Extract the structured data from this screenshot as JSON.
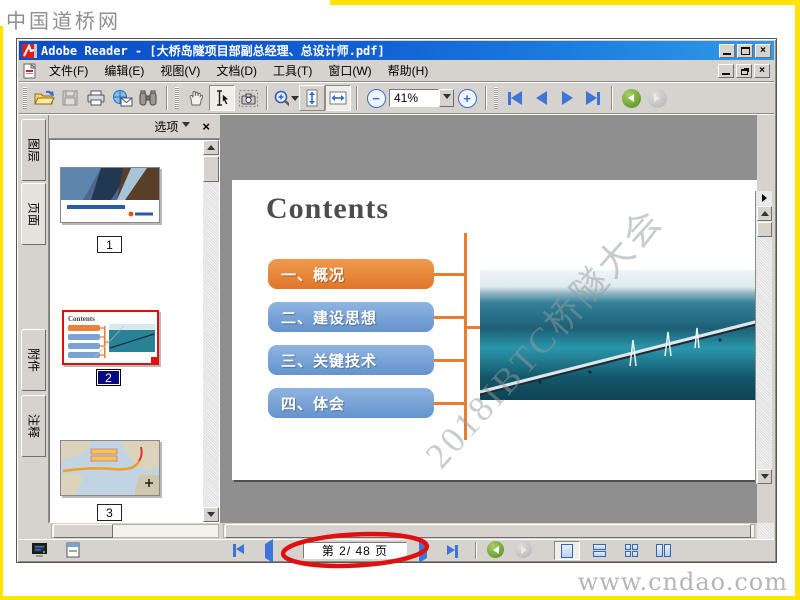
{
  "page": {
    "watermark_top_left": "中国道桥网",
    "watermark_bottom_right": "www.cndao.com",
    "frame_color": "#ffe400"
  },
  "window": {
    "title": "Adobe Reader - [大桥岛隧项目部副总经理、总设计师.pdf]",
    "controls": [
      "minimize",
      "maximize",
      "close"
    ]
  },
  "menu": {
    "items": [
      {
        "label": "文件(F)"
      },
      {
        "label": "编辑(E)"
      },
      {
        "label": "视图(V)"
      },
      {
        "label": "文档(D)"
      },
      {
        "label": "工具(T)"
      },
      {
        "label": "窗口(W)"
      },
      {
        "label": "帮助(H)"
      }
    ],
    "mdi_controls": [
      "minimize",
      "restore",
      "close"
    ]
  },
  "toolbar": {
    "zoom_value": "41%",
    "icons": [
      "open",
      "save",
      "print",
      "email",
      "search",
      "hand-tool",
      "select-tool",
      "snapshot",
      "zoom-tool",
      "fit-page",
      "fit-width",
      "zoom-out",
      "zoom-in",
      "first-page",
      "previous-page",
      "next-page",
      "last-page",
      "go-back",
      "go-forward"
    ],
    "active_tools": [
      "select-tool",
      "fit-width"
    ]
  },
  "sidebar": {
    "tabs": [
      {
        "label": "图层",
        "active": false
      },
      {
        "label": "页面",
        "active": true
      },
      {
        "label": "附件",
        "active": false
      },
      {
        "label": "注释",
        "active": false
      }
    ],
    "panel_header": {
      "options_label": "选项",
      "close_glyph": "×"
    },
    "thumbnails": [
      {
        "page_number": "1",
        "selected": false
      },
      {
        "page_number": "2",
        "selected": true
      },
      {
        "page_number": "3",
        "selected": false
      }
    ]
  },
  "slide": {
    "title": "Contents",
    "items": [
      {
        "label": "一、概况",
        "color": "#e8803a"
      },
      {
        "label": "二、建设思想",
        "color": "#6f9fd6"
      },
      {
        "label": "三、关键技术",
        "color": "#6f9fd6"
      },
      {
        "label": "四、体会",
        "color": "#6f9fd6"
      }
    ],
    "connector_color": "#e87d2e",
    "watermark": "2018IBTC桥隧大会"
  },
  "statusbar": {
    "page_indicator": "第 2/ 48 页",
    "layout_modes": [
      "single-page",
      "continuous",
      "facing",
      "continuous-facing"
    ],
    "active_layout": "single-page"
  },
  "colors": {
    "titlebar_left": "#0b4ec6",
    "titlebar_right": "#2f9ae8",
    "chrome": "#d6d3ce",
    "doc_background": "#8f8f8f",
    "selection_navy": "#0a0a80",
    "annotation_red": "#e01010"
  }
}
